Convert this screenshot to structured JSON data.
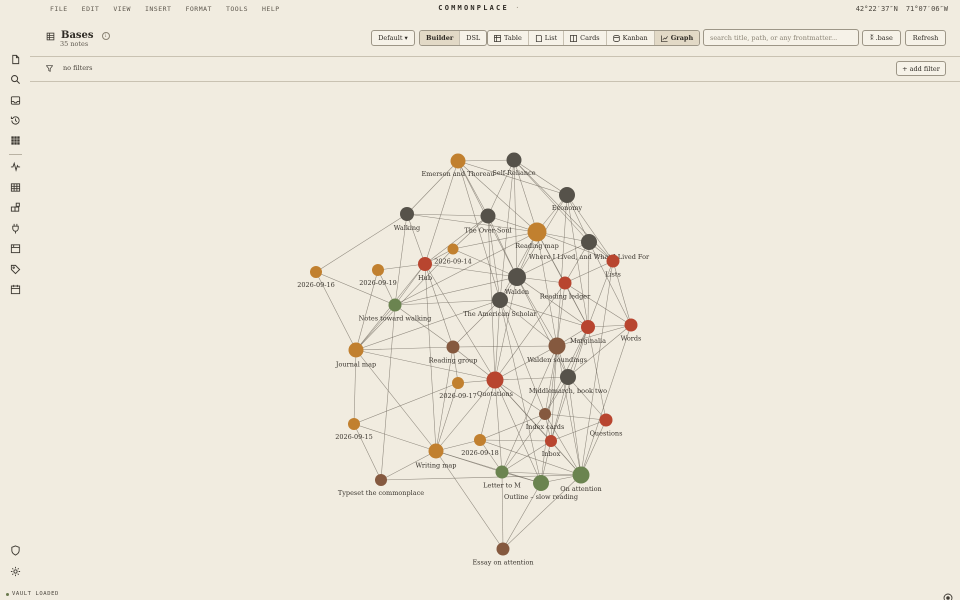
{
  "menu": [
    "FILE",
    "EDIT",
    "VIEW",
    "INSERT",
    "FORMAT",
    "TOOLS",
    "HELP"
  ],
  "app": {
    "name": "COMMONPLACE",
    "dot": "·"
  },
  "coords": {
    "lat": "42°22′37″N",
    "lon": "71°07′06″W"
  },
  "sidebar": {
    "top": [
      "file-icon",
      "search-icon",
      "inbox-icon",
      "history-icon",
      "grid-icon"
    ],
    "bottom": [
      "activity-icon",
      "table-icon",
      "blocks-icon",
      "plug-icon",
      "calendar-grid-icon",
      "tag-icon",
      "calendar-icon"
    ],
    "footer": [
      "shield-icon",
      "gear-icon"
    ]
  },
  "header": {
    "title": "Bases",
    "notes_count": "35 notes"
  },
  "toolbar": {
    "view_select": "Default ▾",
    "mode": [
      "Builder",
      "DSL"
    ],
    "mode_active": 0,
    "views": [
      {
        "label": "Table",
        "icon": "table-icon"
      },
      {
        "label": "List",
        "icon": "list-icon"
      },
      {
        "label": "Cards",
        "icon": "cards-icon"
      },
      {
        "label": "Kanban",
        "icon": "kanban-icon"
      },
      {
        "label": "Graph",
        "icon": "graph-icon"
      }
    ],
    "views_active": 4,
    "search_placeholder": "search title, path, or any frontmatter...",
    "base_button": "⁑ .base",
    "refresh": "Refresh"
  },
  "filters": {
    "label": "no filters",
    "add": "+ add filter"
  },
  "status": {
    "text": "VAULT LOADED"
  },
  "colors": {
    "background": "#f1ece0",
    "dark": "#56524a",
    "ochre": "#c1802f",
    "red": "#b8452f",
    "olive": "#6b8450",
    "brown": "#85593f",
    "edge": "#6c665b"
  },
  "graph": {
    "nodes": [
      {
        "id": "emerson",
        "label": "Emerson and Thoreau",
        "color": "ochre"
      },
      {
        "id": "selfrel",
        "label": "Self-Reliance",
        "color": "dark"
      },
      {
        "id": "economy",
        "label": "Economy",
        "color": "dark"
      },
      {
        "id": "walking",
        "label": "Walking",
        "color": "dark"
      },
      {
        "id": "oversoul",
        "label": "The Over-Soul",
        "color": "dark"
      },
      {
        "id": "readmap",
        "label": "Reading map",
        "color": "ochre"
      },
      {
        "id": "whereilived",
        "label": "Where I Lived, and What I Lived For",
        "color": "dark"
      },
      {
        "id": "d0914",
        "label": "2026-09-14",
        "color": "ochre"
      },
      {
        "id": "hub",
        "label": "Hub",
        "color": "red"
      },
      {
        "id": "lists",
        "label": "Lists",
        "color": "red"
      },
      {
        "id": "d0916",
        "label": "2026-09-16",
        "color": "ochre"
      },
      {
        "id": "d0919",
        "label": "2026-09-19",
        "color": "ochre"
      },
      {
        "id": "walden",
        "label": "Walden",
        "color": "dark"
      },
      {
        "id": "ledger",
        "label": "Reading ledger",
        "color": "red"
      },
      {
        "id": "notes",
        "label": "Notes toward walking",
        "color": "olive"
      },
      {
        "id": "amscholar",
        "label": "The American Scholar",
        "color": "dark"
      },
      {
        "id": "marginalia",
        "label": "Marginalia",
        "color": "red"
      },
      {
        "id": "words",
        "label": "Words",
        "color": "red"
      },
      {
        "id": "journal",
        "label": "Journal map",
        "color": "ochre"
      },
      {
        "id": "rgroup",
        "label": "Reading group",
        "color": "brown"
      },
      {
        "id": "wsound",
        "label": "Walden soundings",
        "color": "brown"
      },
      {
        "id": "middle",
        "label": "Middlemarch, book two",
        "color": "dark"
      },
      {
        "id": "d0917",
        "label": "2026-09-17",
        "color": "ochre"
      },
      {
        "id": "quot",
        "label": "Quotations",
        "color": "red"
      },
      {
        "id": "index",
        "label": "Index cards",
        "color": "brown"
      },
      {
        "id": "questions",
        "label": "Questions",
        "color": "red"
      },
      {
        "id": "d0915",
        "label": "2026-09-15",
        "color": "ochre"
      },
      {
        "id": "inbox",
        "label": "Inbox",
        "color": "red"
      },
      {
        "id": "d0918",
        "label": "2026-09-18",
        "color": "ochre"
      },
      {
        "id": "wmap",
        "label": "Writing map",
        "color": "ochre"
      },
      {
        "id": "letter",
        "label": "Letter to M",
        "color": "olive"
      },
      {
        "id": "attention",
        "label": "On attention",
        "color": "olive"
      },
      {
        "id": "outline",
        "label": "Outline – slow reading",
        "color": "olive"
      },
      {
        "id": "typeset",
        "label": "Typeset the commonplace",
        "color": "brown"
      },
      {
        "id": "essay",
        "label": "Essay on attention",
        "color": "brown"
      }
    ],
    "edges": [
      [
        "emerson",
        "selfrel"
      ],
      [
        "emerson",
        "oversoul"
      ],
      [
        "emerson",
        "readmap"
      ],
      [
        "emerson",
        "hub"
      ],
      [
        "emerson",
        "walden"
      ],
      [
        "emerson",
        "walking"
      ],
      [
        "emerson",
        "economy"
      ],
      [
        "emerson",
        "amscholar"
      ],
      [
        "selfrel",
        "oversoul"
      ],
      [
        "selfrel",
        "economy"
      ],
      [
        "selfrel",
        "readmap"
      ],
      [
        "selfrel",
        "walden"
      ],
      [
        "selfrel",
        "whereilived"
      ],
      [
        "selfrel",
        "amscholar"
      ],
      [
        "selfrel",
        "lists"
      ],
      [
        "economy",
        "whereilived"
      ],
      [
        "economy",
        "readmap"
      ],
      [
        "economy",
        "walden"
      ],
      [
        "economy",
        "marginalia"
      ],
      [
        "economy",
        "wsound"
      ],
      [
        "economy",
        "lists"
      ],
      [
        "walking",
        "oversoul"
      ],
      [
        "walking",
        "notes"
      ],
      [
        "walking",
        "d0916"
      ],
      [
        "walking",
        "readmap"
      ],
      [
        "walking",
        "hub"
      ],
      [
        "oversoul",
        "readmap"
      ],
      [
        "oversoul",
        "walden"
      ],
      [
        "oversoul",
        "amscholar"
      ],
      [
        "oversoul",
        "d0914"
      ],
      [
        "oversoul",
        "hub"
      ],
      [
        "oversoul",
        "quot"
      ],
      [
        "readmap",
        "whereilived"
      ],
      [
        "readmap",
        "d0914"
      ],
      [
        "readmap",
        "walden"
      ],
      [
        "readmap",
        "ledger"
      ],
      [
        "readmap",
        "lists"
      ],
      [
        "readmap",
        "marginalia"
      ],
      [
        "readmap",
        "wsound"
      ],
      [
        "readmap",
        "notes"
      ],
      [
        "readmap",
        "amscholar"
      ],
      [
        "whereilived",
        "lists"
      ],
      [
        "whereilived",
        "walden"
      ],
      [
        "whereilived",
        "ledger"
      ],
      [
        "whereilived",
        "marginalia"
      ],
      [
        "whereilived",
        "words"
      ],
      [
        "d0914",
        "hub"
      ],
      [
        "d0914",
        "walden"
      ],
      [
        "d0914",
        "journal"
      ],
      [
        "hub",
        "notes"
      ],
      [
        "hub",
        "journal"
      ],
      [
        "hub",
        "wmap"
      ],
      [
        "hub",
        "walden"
      ],
      [
        "hub",
        "quot"
      ],
      [
        "hub",
        "rgroup"
      ],
      [
        "hub",
        "d0919"
      ],
      [
        "lists",
        "words"
      ],
      [
        "lists",
        "marginalia"
      ],
      [
        "lists",
        "ledger"
      ],
      [
        "lists",
        "attention"
      ],
      [
        "d0916",
        "notes"
      ],
      [
        "d0916",
        "journal"
      ],
      [
        "d0919",
        "notes"
      ],
      [
        "d0919",
        "journal"
      ],
      [
        "walden",
        "amscholar"
      ],
      [
        "walden",
        "ledger"
      ],
      [
        "walden",
        "wsound"
      ],
      [
        "walden",
        "marginalia"
      ],
      [
        "walden",
        "middle"
      ],
      [
        "walden",
        "quot"
      ],
      [
        "ledger",
        "marginalia"
      ],
      [
        "ledger",
        "wsound"
      ],
      [
        "ledger",
        "quot"
      ],
      [
        "ledger",
        "words"
      ],
      [
        "notes",
        "journal"
      ],
      [
        "notes",
        "amscholar"
      ],
      [
        "notes",
        "walden"
      ],
      [
        "notes",
        "rgroup"
      ],
      [
        "notes",
        "typeset"
      ],
      [
        "amscholar",
        "wsound"
      ],
      [
        "amscholar",
        "quot"
      ],
      [
        "amscholar",
        "rgroup"
      ],
      [
        "amscholar",
        "marginalia"
      ],
      [
        "amscholar",
        "index"
      ],
      [
        "amscholar",
        "outline"
      ],
      [
        "marginalia",
        "words"
      ],
      [
        "marginalia",
        "wsound"
      ],
      [
        "marginalia",
        "middle"
      ],
      [
        "marginalia",
        "questions"
      ],
      [
        "marginalia",
        "inbox"
      ],
      [
        "marginalia",
        "index"
      ],
      [
        "words",
        "wsound"
      ],
      [
        "words",
        "attention"
      ],
      [
        "words",
        "middle"
      ],
      [
        "journal",
        "rgroup"
      ],
      [
        "journal",
        "d0915"
      ],
      [
        "journal",
        "wmap"
      ],
      [
        "journal",
        "quot"
      ],
      [
        "journal",
        "amscholar"
      ],
      [
        "rgroup",
        "wsound"
      ],
      [
        "rgroup",
        "quot"
      ],
      [
        "rgroup",
        "d0917"
      ],
      [
        "rgroup",
        "wmap"
      ],
      [
        "wsound",
        "middle"
      ],
      [
        "wsound",
        "quot"
      ],
      [
        "wsound",
        "index"
      ],
      [
        "wsound",
        "inbox"
      ],
      [
        "wsound",
        "attention"
      ],
      [
        "wsound",
        "outline"
      ],
      [
        "wsound",
        "letter"
      ],
      [
        "middle",
        "quot"
      ],
      [
        "middle",
        "index"
      ],
      [
        "middle",
        "questions"
      ],
      [
        "middle",
        "attention"
      ],
      [
        "middle",
        "inbox"
      ],
      [
        "d0917",
        "quot"
      ],
      [
        "d0917",
        "d0915"
      ],
      [
        "d0917",
        "wmap"
      ],
      [
        "quot",
        "index"
      ],
      [
        "quot",
        "inbox"
      ],
      [
        "quot",
        "wmap"
      ],
      [
        "quot",
        "d0918"
      ],
      [
        "quot",
        "letter"
      ],
      [
        "quot",
        "attention"
      ],
      [
        "quot",
        "outline"
      ],
      [
        "index",
        "inbox"
      ],
      [
        "index",
        "attention"
      ],
      [
        "index",
        "questions"
      ],
      [
        "index",
        "letter"
      ],
      [
        "index",
        "d0918"
      ],
      [
        "questions",
        "attention"
      ],
      [
        "questions",
        "inbox"
      ],
      [
        "d0915",
        "typeset"
      ],
      [
        "d0915",
        "wmap"
      ],
      [
        "inbox",
        "attention"
      ],
      [
        "inbox",
        "letter"
      ],
      [
        "inbox",
        "d0918"
      ],
      [
        "inbox",
        "outline"
      ],
      [
        "d0918",
        "wmap"
      ],
      [
        "d0918",
        "letter"
      ],
      [
        "d0918",
        "attention"
      ],
      [
        "wmap",
        "letter"
      ],
      [
        "wmap",
        "typeset"
      ],
      [
        "wmap",
        "essay"
      ],
      [
        "wmap",
        "outline"
      ],
      [
        "letter",
        "outline"
      ],
      [
        "letter",
        "attention"
      ],
      [
        "letter",
        "essay"
      ],
      [
        "outline",
        "attention"
      ],
      [
        "outline",
        "essay"
      ],
      [
        "attention",
        "essay"
      ],
      [
        "attention",
        "typeset"
      ]
    ]
  }
}
